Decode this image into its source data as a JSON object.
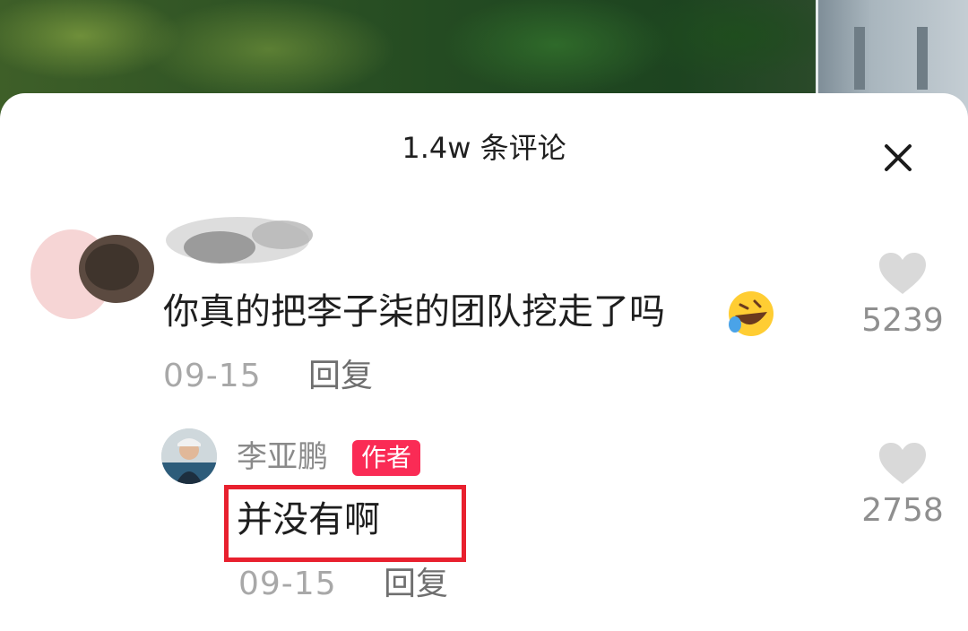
{
  "panel": {
    "title": "1.4w 条评论",
    "close_label": "×"
  },
  "comments": [
    {
      "text": "你真的把李子柒的团队挖走了吗",
      "emoji": "rolling-on-floor-laughing-emoji",
      "date": "09-15",
      "reply_label": "回复",
      "likes": "5239"
    }
  ],
  "reply": {
    "author": "李亚鹏",
    "badge": "作者",
    "text": "并没有啊",
    "date": "09-15",
    "reply_label": "回复",
    "likes": "2758"
  },
  "colors": {
    "badge_bg": "#fa2b55",
    "highlight_border": "#e8202e",
    "heart": "#d9d9d9"
  }
}
